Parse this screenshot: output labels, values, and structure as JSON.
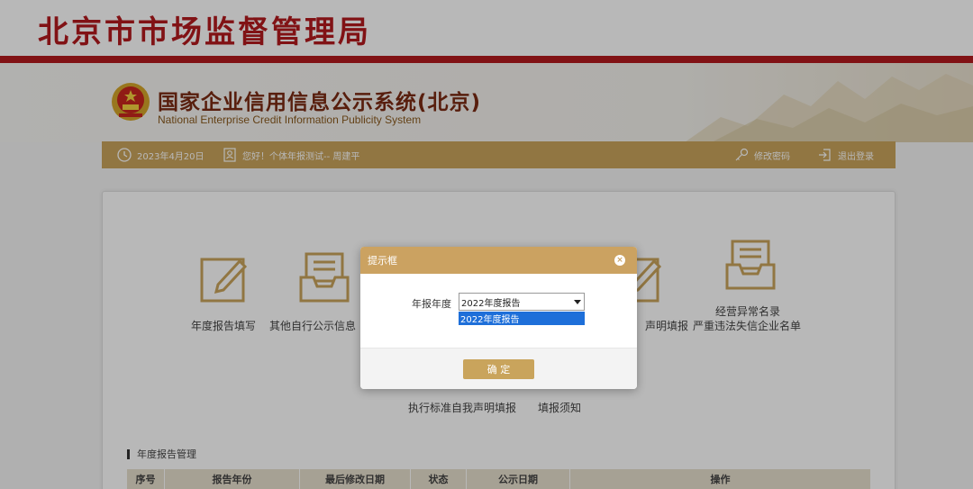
{
  "site": {
    "title": "北京市市场监督管理局"
  },
  "system": {
    "title": "国家企业信用信息公示系统(北京)",
    "subtitle": "National Enterprise Credit Information Publicity System"
  },
  "toolbar": {
    "date": "2023年4月20日",
    "greeting": "您好！个体年报测试-- 周建平",
    "change_password": "修改密码",
    "logout": "退出登录"
  },
  "functions": {
    "annual_report": "年度报告填写",
    "other_disclosure": "其他自行公示信息",
    "declaration": "声明填报",
    "abnormal_line1": "经营异常名录",
    "abnormal_line2": "严重违法失信企业名单"
  },
  "links": {
    "standard_declaration": "执行标准自我声明填报",
    "instructions": "填报须知"
  },
  "section": {
    "title": "年度报告管理",
    "columns": [
      "序号",
      "报告年份",
      "最后修改日期",
      "状态",
      "公示日期",
      "操作"
    ]
  },
  "modal": {
    "title": "提示框",
    "close": "×",
    "field_label": "年报年度",
    "selected": "2022年度报告",
    "options": [
      "2022年度报告"
    ],
    "confirm": "确 定"
  },
  "colors": {
    "brand_red": "#b3191e",
    "gold": "#c9a45c",
    "select_highlight": "#1e6fd9"
  }
}
